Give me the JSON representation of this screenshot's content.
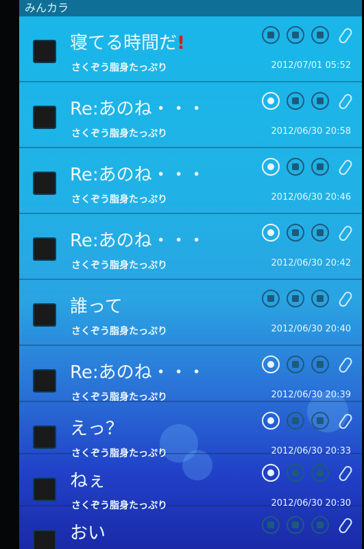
{
  "app": {
    "title": "みんカラ"
  },
  "messages": [
    {
      "subject": "寝てる時間だ",
      "flag": "!",
      "sender": "さくぞう脂身たっぷり",
      "date": "2012/07/01 05:52"
    },
    {
      "subject": "Re:あのね・・・",
      "sender": "さくぞう脂身たっぷり",
      "date": "2012/06/30 20:58"
    },
    {
      "subject": "Re:あのね・・・",
      "sender": "さくぞう脂身たっぷり",
      "date": "2012/06/30 20:46"
    },
    {
      "subject": "Re:あのね・・・",
      "sender": "さくぞう脂身たっぷり",
      "date": "2012/06/30 20:42"
    },
    {
      "subject": "誰って",
      "sender": "さくぞう脂身たっぷり",
      "date": "2012/06/30 20:40"
    },
    {
      "subject": "Re:あのね・・・",
      "sender": "さくぞう脂身たっぷり",
      "date": "2012/06/30 20:39"
    },
    {
      "subject": "えっ？",
      "sender": "さくぞう脂身たっぷり",
      "date": "2012/06/30 20:33"
    },
    {
      "subject": "ねぇ",
      "sender": "さくぞう脂身たっぷり",
      "date": "2012/06/30 20:30"
    },
    {
      "subject": "おい",
      "sender": "",
      "date": ""
    }
  ],
  "colors": {
    "accent": "#19b7ea",
    "flag": "#e01818"
  },
  "icons": [
    "reply-icon",
    "mail-icon",
    "lock-icon",
    "attachment-icon"
  ]
}
